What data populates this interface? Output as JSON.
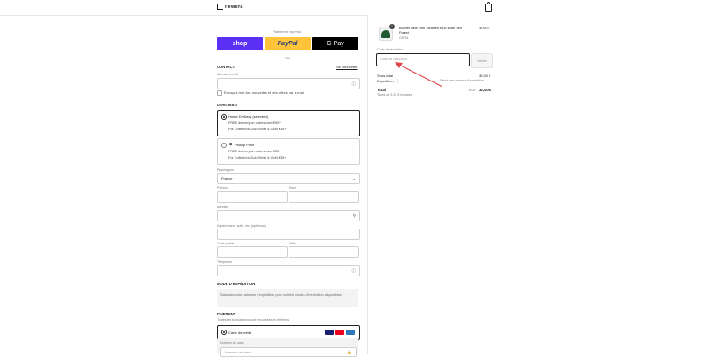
{
  "header": {
    "logo_text": "newera"
  },
  "express": {
    "title": "Paiement express",
    "buttons": {
      "shop": "shop",
      "paypal": "PayPal",
      "gpay": "G Pay"
    },
    "or": "OU"
  },
  "contact": {
    "heading": "CONTACT",
    "login_link": "Se connecter",
    "email_placeholder": "Adresse e-mail",
    "newsletter_label": "Envoyez-moi des nouvelles et des offres par e-mail"
  },
  "delivery": {
    "heading": "LIVRAISON",
    "options": [
      {
        "title": "Home Delivery (selected)",
        "line1": "FREE delivery on orders over €50*",
        "line2": "For Collectors Club Silver & Gold €35+"
      },
      {
        "title": "Pickup Point",
        "line1": "FREE delivery on orders over €50*",
        "line2": "For Collectors Club Silver & Gold €35+"
      }
    ],
    "country_label": "Pays/région",
    "country_value": "France",
    "first_name": "Prénom",
    "last_name": "Nom",
    "address": "Adresse",
    "address2": "Appartement, suite, etc. (optionnel)",
    "postal": "Code postal",
    "city": "Ville",
    "phone": "Téléphone"
  },
  "shipping_method": {
    "heading": "MODE D'EXPÉDITION",
    "notice": "Saisissez votre adresse d'expédition pour voir les modes d'expédition disponibles."
  },
  "payment": {
    "heading": "PAIEMENT",
    "subtitle": "Toutes les transactions sont sécurisées et chiffrées.",
    "card_label": "Carte de crédit",
    "card_number_label": "Numéro de carte",
    "card_number_placeholder": "Numéro de carte"
  },
  "summary": {
    "product_name": "Bonnet New York Yankees MLB Wide Vert Forest",
    "product_variant": "OSFM",
    "product_price": "32,00 €",
    "quantity": "1",
    "discount_label": "Code de réduction",
    "discount_placeholder": "Code de réduction",
    "apply": "Valider",
    "subtotal_label": "Sous-total",
    "subtotal_value": "32,00 €",
    "shipping_label": "Expédition",
    "shipping_value": "Saisir une adresse d'expédition",
    "total_label": "Total",
    "currency": "EUR",
    "total_value": "32,00 €",
    "tax_note": "Taxes de 5,33 € incluses"
  },
  "colors": {
    "shop": "#5a31f4",
    "paypal": "#ffc439",
    "gpay": "#000000",
    "annotation_arrow": "#e04848"
  }
}
